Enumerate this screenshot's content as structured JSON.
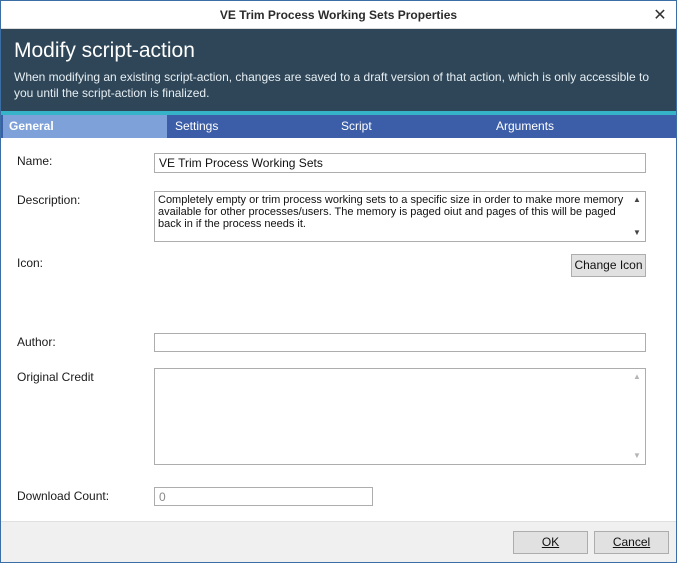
{
  "window": {
    "title": "VE Trim Process Working Sets Properties",
    "close_glyph": "✕"
  },
  "header": {
    "title": "Modify script-action",
    "description": "When modifying an existing script-action, changes are saved to a draft version of that action, which is only accessible to you until the script-action is finalized."
  },
  "tabs": [
    {
      "label": "General",
      "active": true
    },
    {
      "label": "Settings",
      "active": false
    },
    {
      "label": "Script",
      "active": false
    },
    {
      "label": "Arguments",
      "active": false
    }
  ],
  "form": {
    "name_label": "Name:",
    "name_value": "VE Trim Process Working Sets",
    "description_label": "Description:",
    "description_value": "Completely empty or trim process working sets to a specific size in order to make more memory available for other processes/users. The memory is paged oiut and pages of this will be paged back in if the process needs it.",
    "icon_label": "Icon:",
    "change_icon_button": "Change Icon",
    "author_label": "Author:",
    "author_value": "",
    "original_credit_label": "Original Credit",
    "original_credit_value": "",
    "download_count_label": "Download Count:",
    "download_count_value": "0"
  },
  "footer": {
    "ok_label": "OK",
    "cancel_label": "Cancel"
  },
  "colors": {
    "header_bg": "#2e4657",
    "accent": "#36b2c9",
    "tab_bar": "#3c5ea8",
    "active_tab": "#7ea1da"
  },
  "icons": {
    "scroll_up": "▲",
    "scroll_down": "▼"
  }
}
